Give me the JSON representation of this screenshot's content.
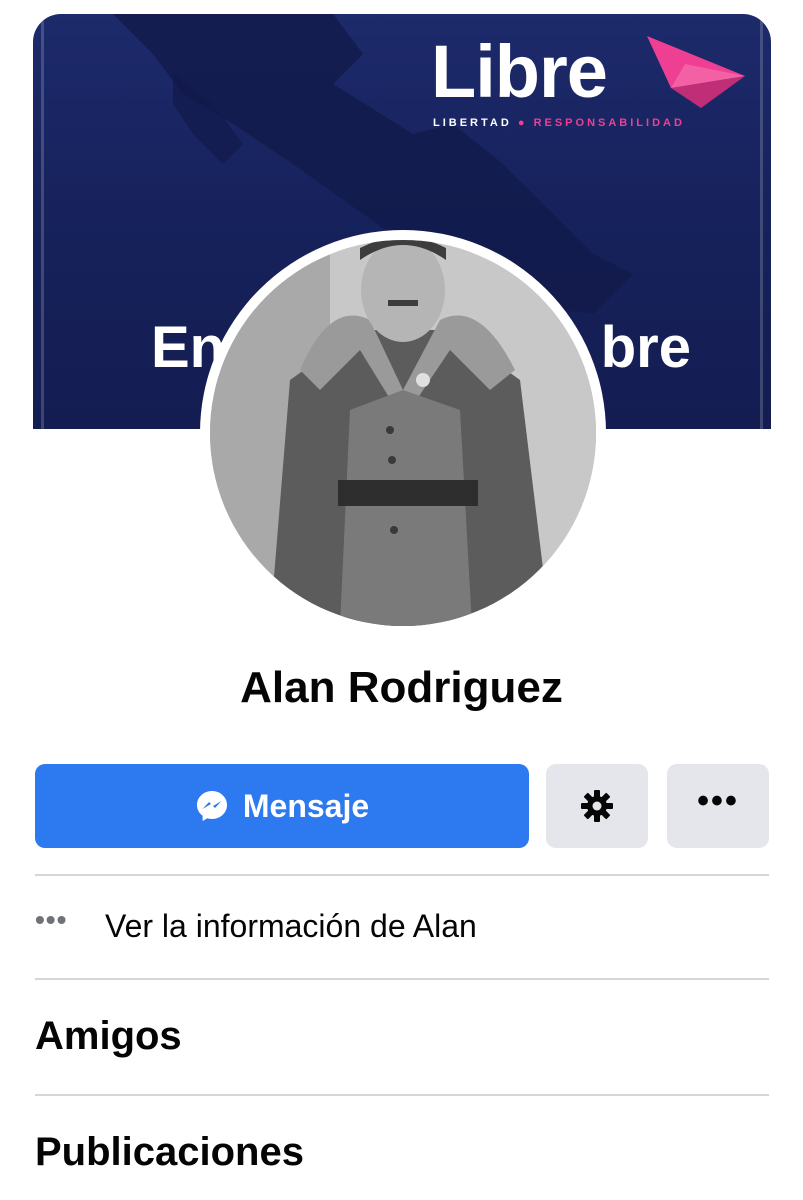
{
  "cover": {
    "brand_name": "Libre",
    "brand_tagline_left": "LIBERTAD",
    "brand_tagline_right": "RESPONSABILIDAD",
    "banner_text_left": "En",
    "banner_text_right": "bre"
  },
  "profile": {
    "name": "Alan Rodriguez"
  },
  "actions": {
    "message_label": "Mensaje",
    "settings_icon": "gear-icon",
    "more_icon": "more-icon",
    "more_glyph": "•••"
  },
  "about": {
    "dots_glyph": "•••",
    "text": "Ver la información de Alan"
  },
  "sections": {
    "friends": "Amigos",
    "posts": "Publicaciones"
  },
  "colors": {
    "primary": "#2d7af0",
    "cover_bg": "#1d2a6b",
    "brand_accent": "#ee3f92",
    "secondary_bg": "#e4e6eb"
  }
}
